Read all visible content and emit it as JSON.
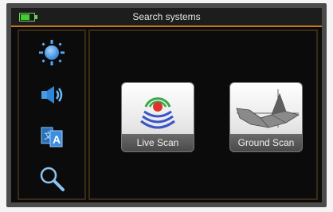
{
  "header": {
    "title": "Search systems",
    "battery_level": 0.7,
    "accent_color": "#c47a1c"
  },
  "sidebar": {
    "items": [
      {
        "icon": "brightness-icon"
      },
      {
        "icon": "speaker-icon"
      },
      {
        "icon": "language-icon"
      },
      {
        "icon": "search-icon"
      }
    ]
  },
  "tiles": [
    {
      "label": "Live Scan",
      "icon": "live-scan-icon"
    },
    {
      "label": "Ground Scan",
      "icon": "ground-scan-icon"
    }
  ]
}
